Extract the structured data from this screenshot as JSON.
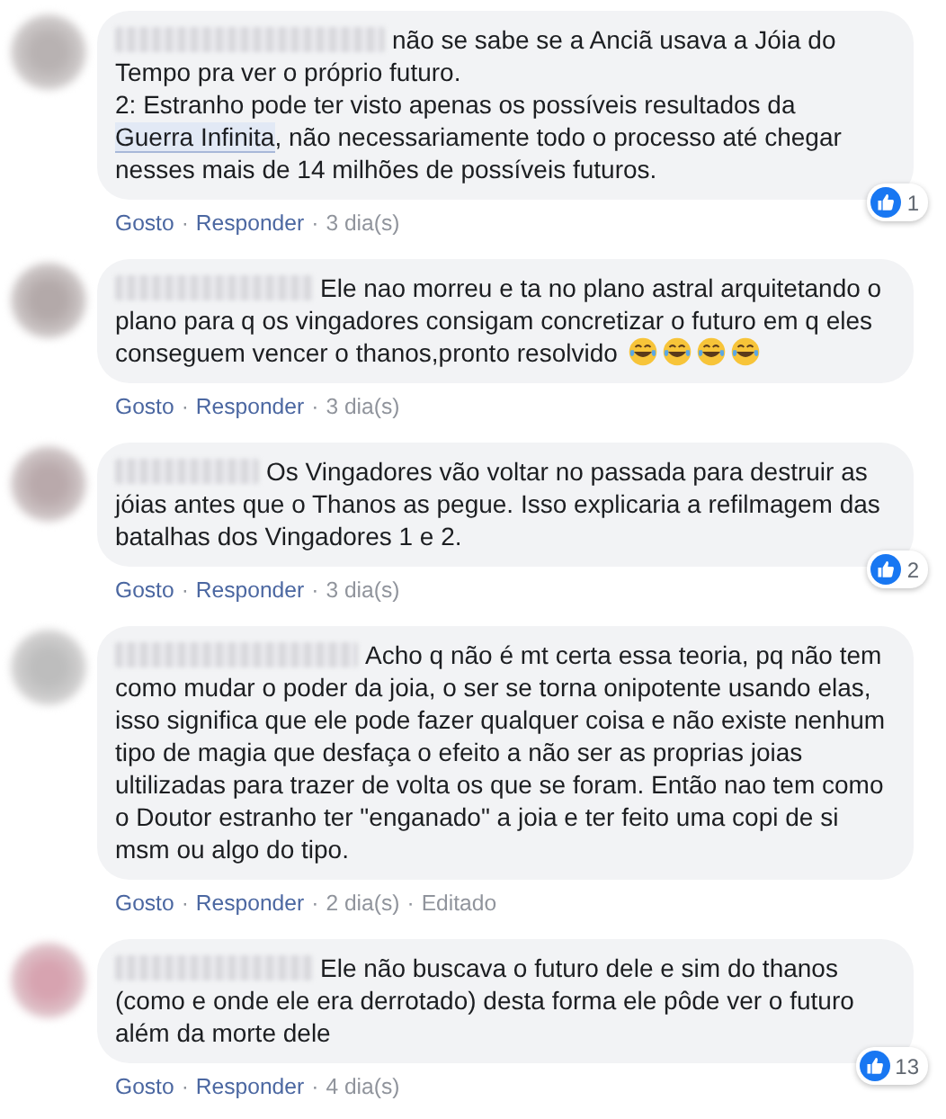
{
  "comments": [
    {
      "color": "#b8b2b2",
      "body": [
        {
          "kind": "plain",
          "text": "não se sabe se a Anciã usava a Jóia do Tempo pra ver o próprio futuro.\n2: Estranho pode ter visto apenas os possíveis resultados da "
        },
        {
          "kind": "tag",
          "text": "Guerra Infinita"
        },
        {
          "kind": "plain",
          "text": ", não necessariamente todo o processo até chegar nesses mais de 14 milhões de possíveis futuros."
        }
      ],
      "reactions": "1",
      "actions": [
        {
          "kind": "link",
          "text": "Gosto"
        },
        {
          "kind": "sep",
          "text": "·"
        },
        {
          "kind": "link",
          "text": "Responder"
        },
        {
          "kind": "sep",
          "text": "·"
        },
        {
          "kind": "meta",
          "text": "3 dia(s)"
        }
      ]
    },
    {
      "color": "#b3a9a9",
      "body": [
        {
          "kind": "plain",
          "text": "Ele nao morreu e ta no plano astral arquitetando o plano para q os vingadores consigam concretizar o futuro em q eles conseguem vencer o thanos,pronto resolvido"
        }
      ],
      "emoji": [
        {
          "kind": "tears-of-joy"
        },
        {
          "kind": "tears-of-joy"
        },
        {
          "kind": "tears-of-joy"
        },
        {
          "kind": "tears-of-joy"
        }
      ],
      "actions": [
        {
          "kind": "link",
          "text": "Gosto"
        },
        {
          "kind": "sep",
          "text": "·"
        },
        {
          "kind": "link",
          "text": "Responder"
        },
        {
          "kind": "sep",
          "text": "·"
        },
        {
          "kind": "meta",
          "text": "3 dia(s)"
        }
      ]
    },
    {
      "color": "#b9a9ab",
      "body": [
        {
          "kind": "plain",
          "text": "Os Vingadores vão voltar no passada para destruir as jóias antes que o Thanos as pegue. Isso explicaria a refilmagem das batalhas dos Vingadores 1 e 2."
        }
      ],
      "reactions": "2",
      "actions": [
        {
          "kind": "link",
          "text": "Gosto"
        },
        {
          "kind": "sep",
          "text": "·"
        },
        {
          "kind": "link",
          "text": "Responder"
        },
        {
          "kind": "sep",
          "text": "·"
        },
        {
          "kind": "meta",
          "text": "3 dia(s)"
        }
      ]
    },
    {
      "color": "#bdbdbd",
      "body": [
        {
          "kind": "plain",
          "text": "Acho q não é mt certa essa teoria, pq não tem como mudar o poder da joia, o ser se torna onipotente usando elas, isso significa que ele pode fazer qualquer coisa e não existe nenhum tipo de magia que desfaça o efeito a não ser as proprias joias ultilizadas para trazer de volta os que se foram. Então nao tem como o Doutor estranho ter \"enganado\" a joia e ter feito uma copi de si msm ou algo do tipo."
        }
      ],
      "actions": [
        {
          "kind": "link",
          "text": "Gosto"
        },
        {
          "kind": "sep",
          "text": "·"
        },
        {
          "kind": "link",
          "text": "Responder"
        },
        {
          "kind": "sep",
          "text": "·"
        },
        {
          "kind": "meta",
          "text": "2 dia(s)"
        },
        {
          "kind": "sep",
          "text": "·"
        },
        {
          "kind": "meta",
          "text": "Editado"
        }
      ]
    },
    {
      "color": "#d7a3b0",
      "body": [
        {
          "kind": "plain",
          "text": "Ele não buscava o futuro dele e sim do thanos (como e onde ele era derrotado) desta forma ele pôde ver o futuro além da morte dele"
        }
      ],
      "reactions": "13",
      "actions": [
        {
          "kind": "link",
          "text": "Gosto"
        },
        {
          "kind": "sep",
          "text": "·"
        },
        {
          "kind": "link",
          "text": "Responder"
        },
        {
          "kind": "sep",
          "text": "·"
        },
        {
          "kind": "meta",
          "text": "4 dia(s)"
        }
      ]
    }
  ]
}
